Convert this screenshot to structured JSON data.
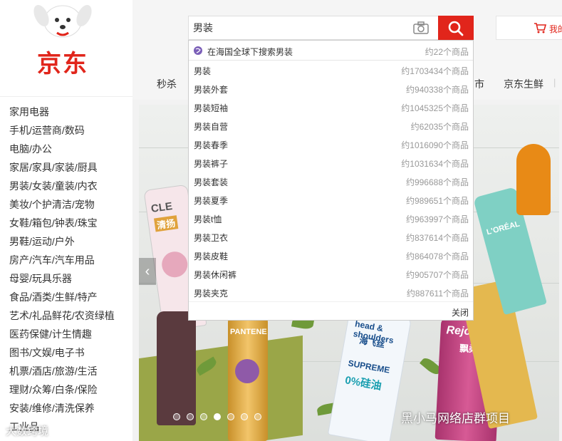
{
  "header": {
    "logo": "京东",
    "search_value": "男装",
    "cart_label": "我的",
    "nav": [
      "秒杀",
      "市",
      "京东生鲜"
    ]
  },
  "categories": [
    "家用电器",
    "手机/运营商/数码",
    "电脑/办公",
    "家居/家具/家装/厨具",
    "男装/女装/童装/内衣",
    "美妆/个护清洁/宠物",
    "女鞋/箱包/钟表/珠宝",
    "男鞋/运动/户外",
    "房产/汽车/汽车用品",
    "母婴/玩具乐器",
    "食品/酒类/生鲜/特产",
    "艺术/礼品鲜花/农资绿植",
    "医药保健/计生情趣",
    "图书/文娱/电子书",
    "机票/酒店/旅游/生活",
    "理财/众筹/白条/保险",
    "安装/维修/清洗保养",
    "工业品"
  ],
  "suggest": {
    "global_text": "在海国全球下搜索男装",
    "global_count": "约22个商品",
    "items": [
      {
        "word": "男装",
        "count": "约1703434个商品"
      },
      {
        "word": "男装外套",
        "count": "约940338个商品"
      },
      {
        "word": "男装短袖",
        "count": "约1045325个商品"
      },
      {
        "word": "男装自营",
        "count": "约62035个商品"
      },
      {
        "word": "男装春季",
        "count": "约1016090个商品"
      },
      {
        "word": "男装裤子",
        "count": "约1031634个商品"
      },
      {
        "word": "男装套装",
        "count": "约996688个商品"
      },
      {
        "word": "男装夏季",
        "count": "约989651个商品"
      },
      {
        "word": "男装t恤",
        "count": "约963997个商品"
      },
      {
        "word": "男装卫衣",
        "count": "约837614个商品"
      },
      {
        "word": "男装皮鞋",
        "count": "约864078个商品"
      },
      {
        "word": "男装休闲裤",
        "count": "约905707个商品"
      },
      {
        "word": "男装夹克",
        "count": "约887611个商品"
      }
    ],
    "close_label": "关闭"
  },
  "banner": {
    "products": [
      "CLE",
      "清扬",
      "PANTENE",
      "head & shoulders",
      "海飞丝",
      "SUPREME",
      "0%硅油",
      "Rejoice",
      "飘柔",
      "L'ORÉAL"
    ],
    "active_dot": 3,
    "dot_count": 7
  },
  "watermarks": {
    "right": "黑小马网络店群项目",
    "left": "大数跨境"
  },
  "colors": {
    "brand": "#e1251b"
  }
}
